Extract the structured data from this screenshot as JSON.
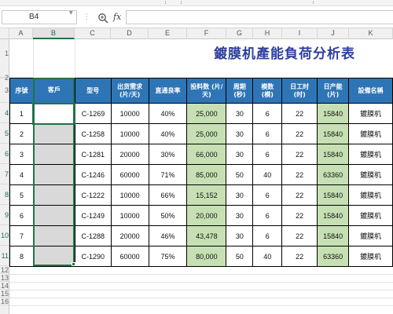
{
  "formula_bar": {
    "name_box": "B4",
    "fx_label": "fx",
    "formula_value": ""
  },
  "columns": [
    "A",
    "B",
    "C",
    "D",
    "E",
    "F",
    "G",
    "H",
    "I",
    "J",
    "K"
  ],
  "rows": [
    "1",
    "2",
    "3",
    "4",
    "5",
    "6",
    "7",
    "8",
    "9",
    "10",
    "11",
    "12",
    "13",
    "14",
    "15",
    "16"
  ],
  "title": "鍍膜机產能負荷分析表",
  "table": {
    "headers": [
      "序號",
      "客戶",
      "型号",
      "出货需求 (片/天)",
      "直通良率",
      "投料数 (片/天)",
      "周期 (秒)",
      "模数 (模)",
      "日工时 (时)",
      "日产能 (片)",
      "設備名稱"
    ],
    "rows": [
      [
        "1",
        "",
        "C-1269",
        "10000",
        "40%",
        "25,000",
        "30",
        "6",
        "22",
        "15840",
        "鍍膜机"
      ],
      [
        "2",
        "",
        "C-1258",
        "10000",
        "40%",
        "25,000",
        "30",
        "6",
        "22",
        "15840",
        "鍍膜机"
      ],
      [
        "3",
        "",
        "C-1281",
        "20000",
        "30%",
        "66,000",
        "30",
        "6",
        "22",
        "15840",
        "鍍膜机"
      ],
      [
        "4",
        "",
        "C-1246",
        "60000",
        "71%",
        "85,000",
        "50",
        "40",
        "22",
        "63360",
        "鍍膜机"
      ],
      [
        "5",
        "",
        "C-1222",
        "10000",
        "66%",
        "15,152",
        "30",
        "6",
        "22",
        "15840",
        "鍍膜机"
      ],
      [
        "6",
        "",
        "C-1249",
        "10000",
        "50%",
        "20,000",
        "30",
        "6",
        "22",
        "15840",
        "鍍膜机"
      ],
      [
        "7",
        "",
        "C-1288",
        "20000",
        "46%",
        "43,478",
        "30",
        "6",
        "22",
        "15840",
        "鍍膜机"
      ],
      [
        "8",
        "",
        "C-1290",
        "60000",
        "75%",
        "80,000",
        "50",
        "40",
        "22",
        "63360",
        "鍍膜机"
      ]
    ]
  },
  "colors": {
    "header_fill": "#2e75b6",
    "title_color": "#2e3f9e",
    "highlight_fill": "#c6e0b4",
    "customer_fill": "#d9d9d9",
    "selection": "#217346"
  }
}
